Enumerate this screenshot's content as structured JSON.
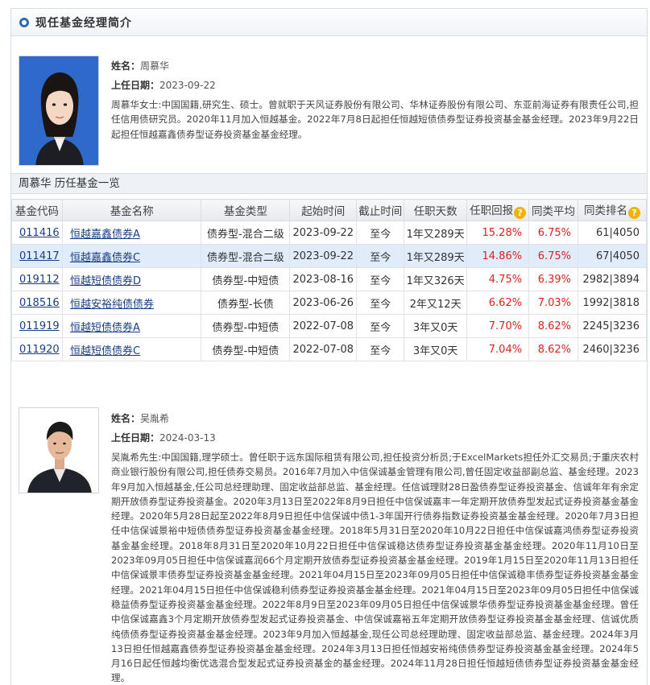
{
  "section_title": "现任基金经理简介",
  "labels": {
    "name": "姓名：",
    "start_date": "上任日期："
  },
  "manager1": {
    "name": "周慕华",
    "start_date": "2023-09-22",
    "bio": "周慕华女士:中国国籍,研究生、硕士。曾就职于天风证券股份有限公司、华林证券股份有限公司、东亚前海证券有限责任公司,担任信用债研究员。2020年11月加入恒越基金。2022年7月8日起担任恒越短债债券型证券投资基金基金经理。2023年9月22日起担任恒越嘉鑫债券型证券投资基金基金经理。"
  },
  "history": {
    "title": "周慕华 历任基金一览",
    "headers": [
      "基金代码",
      "基金名称",
      "基金类型",
      "起始时间",
      "截止时间",
      "任职天数",
      "任职回报",
      "同类平均",
      "同类排名"
    ],
    "help_icon": "?",
    "rows": [
      {
        "code": "011416",
        "name": "恒越嘉鑫债券A",
        "type": "债券型-混合二级",
        "start": "2023-09-22",
        "end": "至今",
        "days": "1年又289天",
        "ret": "15.28%",
        "avg": "6.75%",
        "rank": "61|4050"
      },
      {
        "code": "011417",
        "name": "恒越嘉鑫债券C",
        "type": "债券型-混合二级",
        "start": "2023-09-22",
        "end": "至今",
        "days": "1年又289天",
        "ret": "14.86%",
        "avg": "6.75%",
        "rank": "67|4050"
      },
      {
        "code": "019112",
        "name": "恒越短债债券D",
        "type": "债券型-中短债",
        "start": "2023-08-16",
        "end": "至今",
        "days": "1年又326天",
        "ret": "4.75%",
        "avg": "6.39%",
        "rank": "2982|3894"
      },
      {
        "code": "018516",
        "name": "恒越安裕纯债债券",
        "type": "债券型-长债",
        "start": "2023-06-26",
        "end": "至今",
        "days": "2年又12天",
        "ret": "6.62%",
        "avg": "7.03%",
        "rank": "1992|3818"
      },
      {
        "code": "011919",
        "name": "恒越短债债券A",
        "type": "债券型-中短债",
        "start": "2022-07-08",
        "end": "至今",
        "days": "3年又0天",
        "ret": "7.70%",
        "avg": "8.62%",
        "rank": "2245|3236"
      },
      {
        "code": "011920",
        "name": "恒越短债债券C",
        "type": "债券型-中短债",
        "start": "2022-07-08",
        "end": "至今",
        "days": "3年又0天",
        "ret": "7.04%",
        "avg": "8.62%",
        "rank": "2460|3236"
      }
    ]
  },
  "manager2": {
    "name": "吴胤希",
    "start_date": "2024-03-13",
    "bio": "吴胤希先生:中国国籍,理学硕士。曾任职于远东国际租赁有限公司,担任投资分析员;于ExcelMarkets担任外汇交易员;于重庆农村商业银行股份有限公司,担任债券交易员。2016年7月加入中信保诚基金管理有限公司,曾任固定收益部副总监、基金经理。2023年9月加入恒越基金,任公司总经理助理、固定收益部总监、基金经理。任信诚理财28日盈债券型证券投资基金、信诚年年有余定期开放债券型证券投资基金。2020年3月13日至2022年8月9日担任中信保诚嘉丰一年定期开放债券型发起式证券投资基金基金经理。2020年5月28日起至2022年8月9日担任中信保诚中债1-3年国开行债券指数证券投资基金基金经理。2020年7月3日担任中信保诚景裕中短债债券型证券投资基金基金经理。2018年5月31日至2020年10月22日担任中信保诚嘉鸿债券型证券投资基金基金经理。2018年8月31日至2020年10月22日担任中信保诚稳达债券型证券投资基金基金经理。2020年11月10日至2023年09月05日担任中信保诚嘉润66个月定期开放债券型证券投资基金基金经理。2019年1月15日至2020年11月13日担任中信保诚景丰债券型证券投资基金基金经理。2021年04月15日至2023年09月05日担任中信保诚稳丰债券型证券投资基金基金经理。2021年04月15日担任中信保诚稳利债券型证券投资基金基金经理。2021年04月15日至2023年09月05日担任中信保诚稳益债券型证券投资基金基金经理。2022年8月9日至2023年09月05日担任中信保诚景华债券型证券投资基金基金经理。曾任中信保诚嘉鑫3个月定期开放债券型发起式证券投资基金、中信保诚嘉裕五年定期开放债券型证券投资基金基金经理、信诚优质纯债债券型证券投资基金基金经理。2023年9月加入恒越基金,现任公司总经理助理、固定收益部总监、基金经理。2024年3月13日担任恒越嘉鑫债券型证券投资基金基金经理。2024年3月13日担任恒越安裕纯债债券型证券投资基金基金经理。2024年5月16日起任恒越均衡优选混合型发起式证券投资基金的基金经理。2024年11月28日担任恒越短债债券型证券投资基金基金经理。"
  }
}
